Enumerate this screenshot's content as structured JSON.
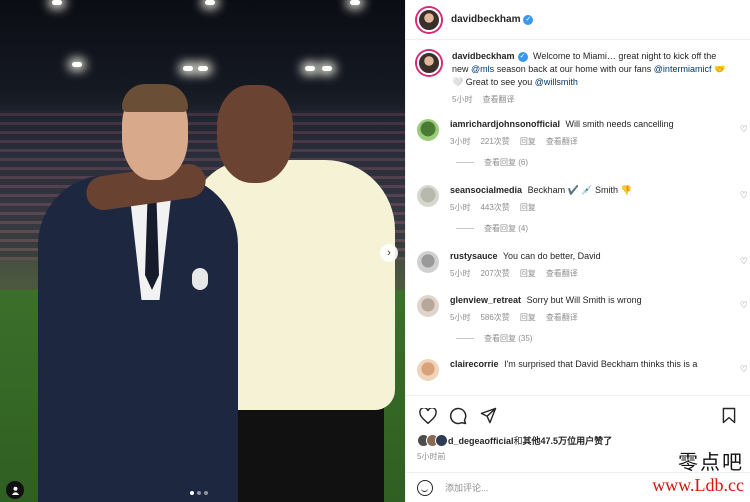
{
  "post": {
    "author": "davidbeckham",
    "caption": {
      "author": "davidbeckham",
      "text_1": "Welcome to Miami… great night to kick off the new",
      "mention_1": "@mls",
      "text_2": "season back at our home with our fans",
      "mention_2": "@intermiamicf",
      "text_3": "🤝🤍 Great to see you",
      "mention_3": "@willsmith",
      "time": "5小时",
      "translate": "查看翻译"
    },
    "comments": [
      {
        "user": "iamrichardjohnsonofficial",
        "text": "Will smith needs cancelling",
        "time": "3小时",
        "likes": "221次赞",
        "reply": "回复",
        "translate": "查看翻译",
        "replies": "查看回复 (6)"
      },
      {
        "user": "seansocialmedia",
        "text": "Beckham ✔️ 💉 Smith 👎",
        "time": "5小时",
        "likes": "443次赞",
        "reply": "回复",
        "replies": "查看回复 (4)"
      },
      {
        "user": "rustysauce",
        "text": "You can do better, David",
        "time": "5小时",
        "likes": "207次赞",
        "reply": "回复",
        "translate": "查看翻译"
      },
      {
        "user": "glenview_retreat",
        "text": "Sorry but Will Smith is wrong",
        "time": "5小时",
        "likes": "586次赞",
        "reply": "回复",
        "translate": "查看翻译",
        "replies": "查看回复 (35)"
      },
      {
        "user": "clairecorrie",
        "text": "I'm surprised that David Beckham thinks this is a"
      }
    ],
    "liked_by": {
      "user": "d_degeaofficial",
      "connector": "和",
      "others": "其他47.5万位用户",
      "suffix": "赞了"
    },
    "time": "5小时前",
    "add_comment_placeholder": "添加评论..."
  },
  "photo": {
    "next": "›"
  },
  "watermark": {
    "cn": "零点吧",
    "url": "www.Ldb.cc"
  },
  "colors": {
    "link": "#00376b",
    "verified": "#3897f0",
    "muted": "#8e8e8e",
    "watermark_red": "#d8140f"
  }
}
